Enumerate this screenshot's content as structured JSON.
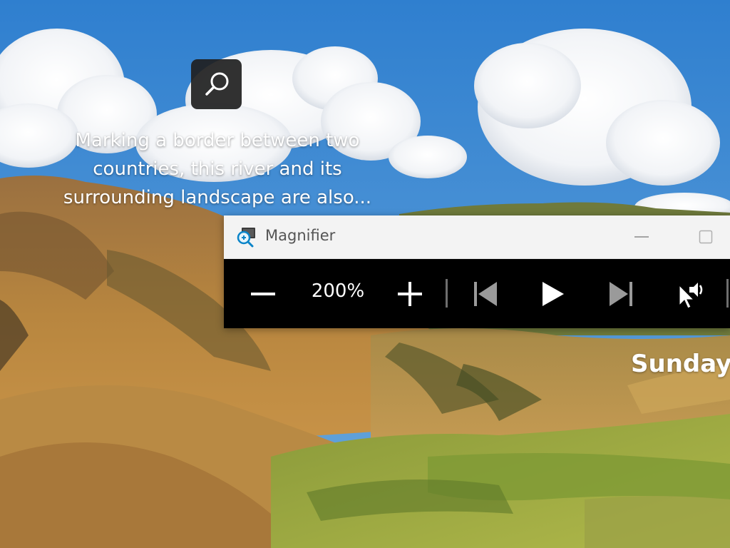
{
  "lock_screen": {
    "caption": "Marking a border between two countries, this river and its surrounding landscape are also...",
    "date": "Sunday,"
  },
  "magnifier": {
    "title": "Magnifier",
    "zoom_level": "200%",
    "icons": {
      "app": "magnifier-app-icon",
      "zoom_out": "minus-icon",
      "zoom_in": "plus-icon",
      "previous": "skip-previous-icon",
      "play": "play-icon",
      "next": "skip-next-icon",
      "read_from_here": "cursor-speaker-icon",
      "minimize": "minimize-icon",
      "maximize": "maximize-icon",
      "info": "search-icon"
    }
  },
  "colors": {
    "toolbar_bg": "#000000",
    "titlebar_bg": "#f3f3f3",
    "icon_active": "#ffffff",
    "icon_dim": "#9a9a9a",
    "accent": "#0a84c8"
  }
}
